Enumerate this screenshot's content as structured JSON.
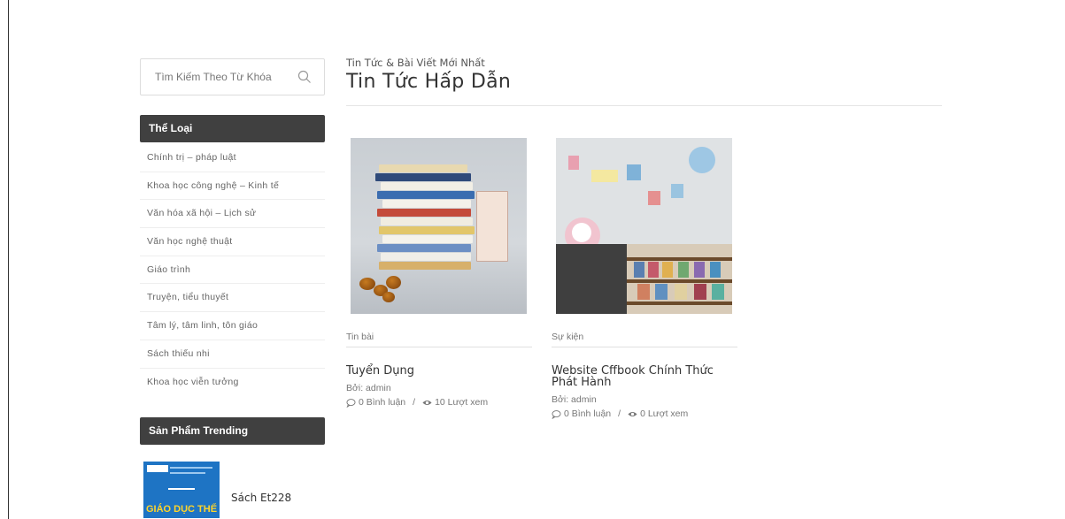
{
  "search": {
    "placeholder": "Tìm Kiếm Theo Từ Khóa",
    "icon": "search-icon"
  },
  "categories": {
    "title": "Thể Loại",
    "items": [
      "Chính trị – pháp luật",
      "Khoa học công nghệ – Kinh tế",
      "Văn hóa xã hội – Lịch sử",
      "Văn học nghệ thuật",
      "Giáo trình",
      "Truyện, tiểu thuyết",
      "Tâm lý, tâm linh, tôn giáo",
      "Sách thiếu nhi",
      "Khoa học viễn tưởng"
    ]
  },
  "trending": {
    "title": "Sản Phẩm Trending",
    "items": [
      {
        "name": "Sách Et228",
        "cover_text": "GIÁO DỤC THỂ CHẤT"
      }
    ]
  },
  "main": {
    "subtitle": "Tin Tức & Bài Viết Mới Nhất",
    "title": "Tin Tức Hấp Dẫn"
  },
  "posts": [
    {
      "category": "Tin bài",
      "title": "Tuyển Dụng",
      "author": "Bởi: admin",
      "comments": "0 Bình luận",
      "views": "10 Lượt xem"
    },
    {
      "category": "Sự kiện",
      "title": "Website Cffbook Chính Thức Phát Hành",
      "author": "Bởi: admin",
      "comments": "0 Bình luận",
      "views": "0 Lượt xem"
    }
  ],
  "colors": {
    "widget_bg": "#404040",
    "text": "#444444",
    "muted": "#777777"
  }
}
